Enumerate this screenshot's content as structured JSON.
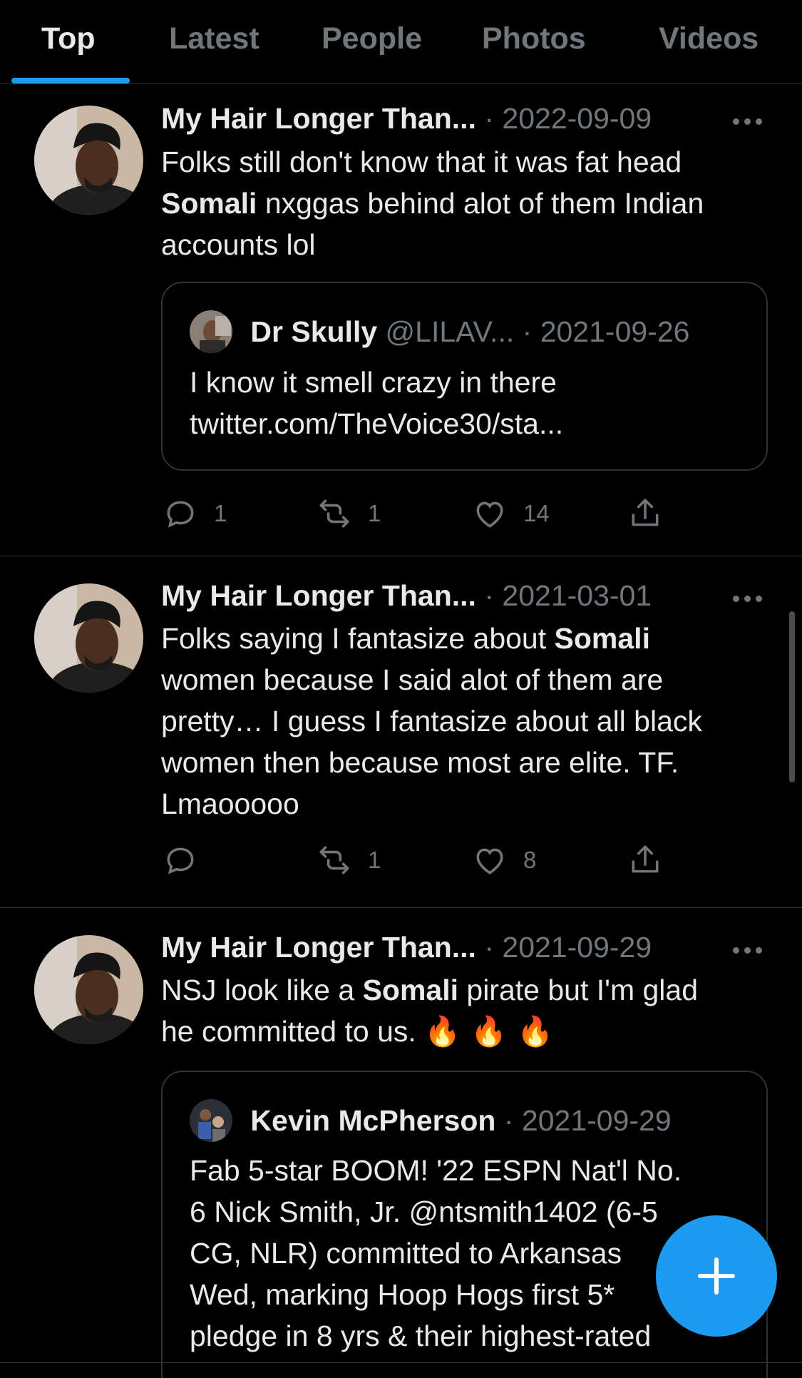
{
  "tabs": [
    {
      "label": "Top",
      "active": true
    },
    {
      "label": "Latest",
      "active": false
    },
    {
      "label": "People",
      "active": false
    },
    {
      "label": "Photos",
      "active": false
    },
    {
      "label": "Videos",
      "active": false
    }
  ],
  "tweets": [
    {
      "author": "My Hair Longer Than...",
      "separator": "·",
      "date": "2022-09-09",
      "text_parts": [
        "Folks still don't know that it was fat head",
        "Somali",
        " nxggas behind alot of them Indian",
        "accounts lol"
      ],
      "quote": {
        "name": "Dr Skully",
        "handle": "@LILAV...",
        "separator": "·",
        "date": "2021-09-26",
        "lines": [
          "I know it smell crazy in there",
          "twitter.com/TheVoice30/sta..."
        ]
      },
      "replies": "1",
      "retweets": "1",
      "likes": "14"
    },
    {
      "author": "My Hair Longer Than...",
      "separator": "·",
      "date": "2021-03-01",
      "text_parts": [
        "Folks saying I fantasize about ",
        "Somali",
        "women because I said alot of them are",
        "pretty… I guess I fantasize about all black",
        "women then because most are elite. TF.",
        "Lmaooooo"
      ],
      "replies": "",
      "retweets": "1",
      "likes": "8"
    },
    {
      "author": "My Hair Longer Than...",
      "separator": "·",
      "date": "2021-09-29",
      "text_parts": [
        "NSJ look like a ",
        "Somali",
        " pirate but I'm glad",
        "he committed to us. ",
        "🔥🔥🔥"
      ],
      "quote": {
        "name": "Kevin McPherson",
        "separator": "·",
        "date": "2021-09-29",
        "lines": [
          "Fab 5-star BOOM! '22 ESPN Nat'l No.",
          "6 Nick Smith, Jr. @ntsmith1402 (6-5",
          "CG, NLR) committed to Arkansas",
          "Wed, marking Hoop Hogs first 5*",
          "pledge in 8 yrs & their highest-rated"
        ]
      }
    }
  ],
  "colors": {
    "accent": "#1d9bf0",
    "muted": "#71767b",
    "text": "#e7e9ea",
    "border": "#2f3336"
  },
  "icons": [
    "reply-icon",
    "retweet-icon",
    "like-icon",
    "share-icon",
    "more-icon",
    "compose-plus-icon"
  ]
}
